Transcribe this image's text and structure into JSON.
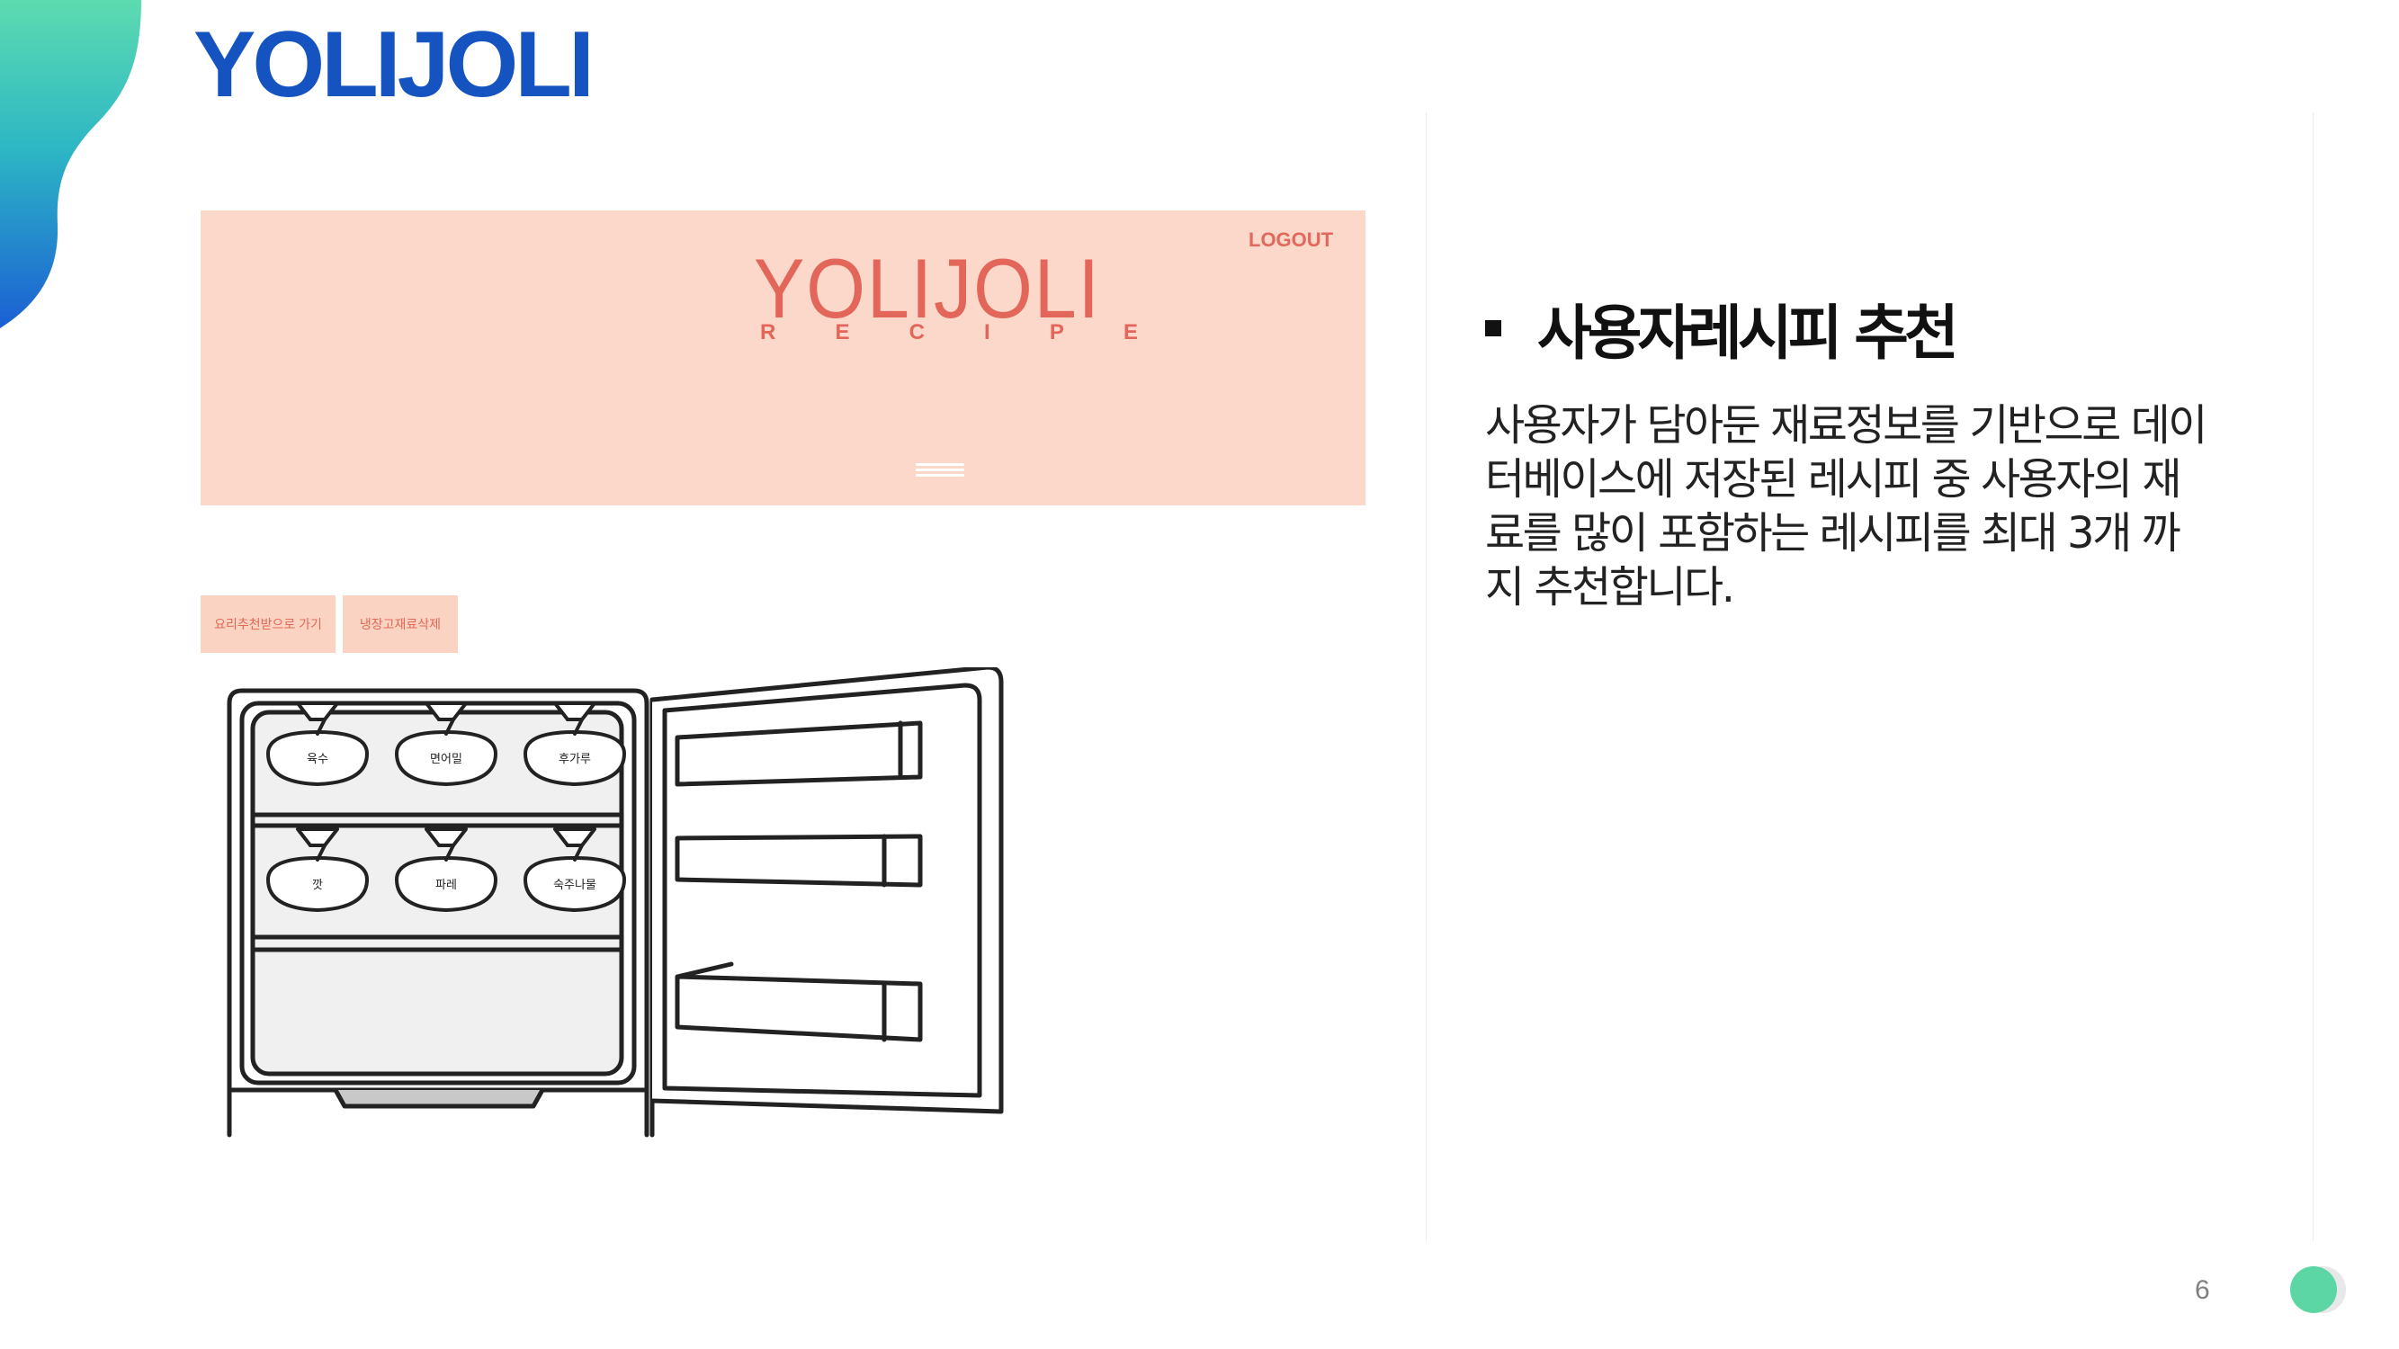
{
  "slide": {
    "brand_title": "YOLIJOLI",
    "page_number": "6",
    "colors": {
      "brand_blue": "#1554c0",
      "accent_green": "#5dd6a6",
      "banner_peach": "#fcd8cb",
      "banner_text": "#e3665a"
    }
  },
  "app_screenshot": {
    "logo": "YOLIJOLI",
    "logo_sub_letters": [
      "R",
      "E",
      "C",
      "I",
      "P",
      "E"
    ],
    "logout_label": "LOGOUT",
    "menu_icon": "hamburger-icon",
    "buttons": [
      "요리추천받으로 가기",
      "냉장고재료삭제"
    ],
    "fridge_ingredients": [
      {
        "label": "육수"
      },
      {
        "label": "면어밀"
      },
      {
        "label": "후가루"
      },
      {
        "label": "깟"
      },
      {
        "label": "파레"
      },
      {
        "label": "숙주나물"
      }
    ]
  },
  "section": {
    "heading": "사용자레시피 추천",
    "body": "사용자가 담아둔 재료정보를 기반으로 데이\n터베이스에 저장된 레시피 중 사용자의  재\n료를 많이 포함하는 레시피를 최대 3개  까\n지 추천합니다."
  }
}
